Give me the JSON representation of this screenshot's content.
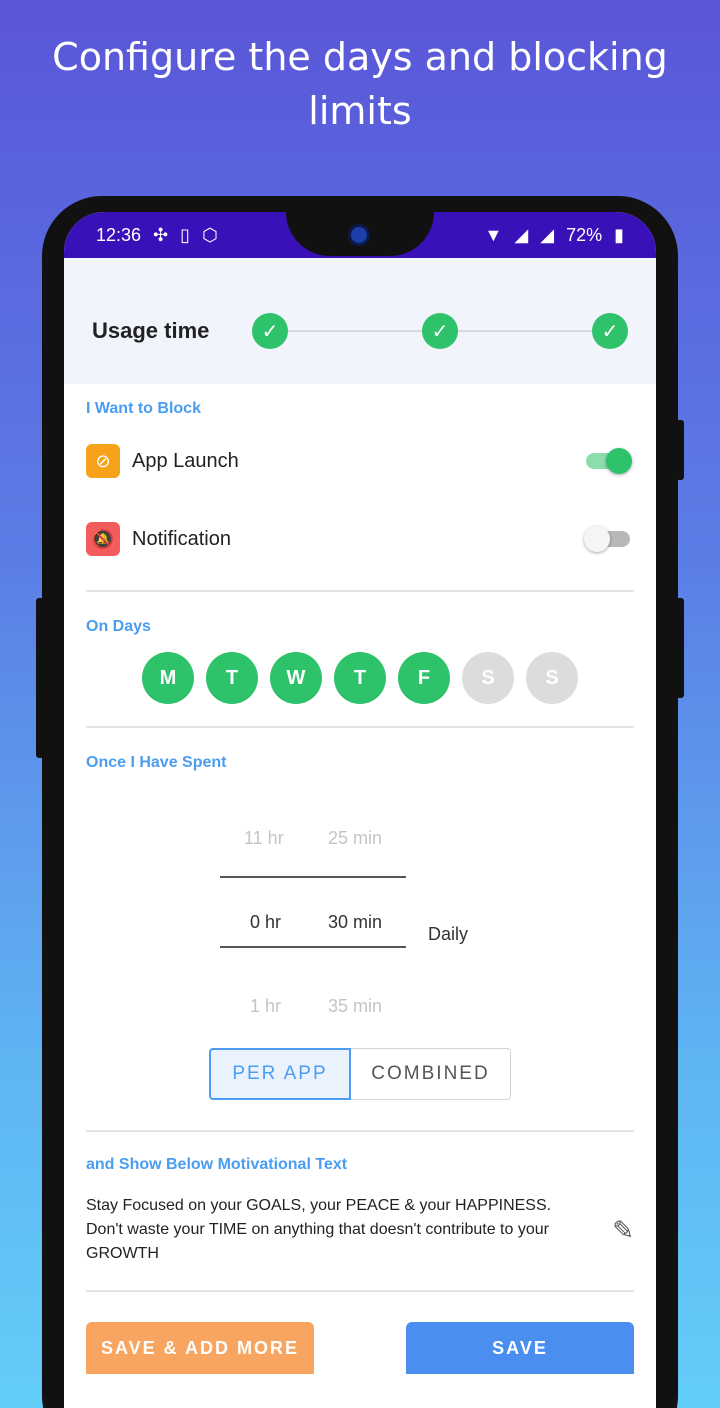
{
  "promo": {
    "title": "Configure the days and blocking limits"
  },
  "status_bar": {
    "time": "12:36",
    "battery": "72%"
  },
  "header": {
    "title": "Usage time"
  },
  "block_section": {
    "label": "I Want to Block",
    "items": [
      {
        "label": "App Launch",
        "enabled": true,
        "icon": "eye-off-icon",
        "icon_color": "#f7a21b"
      },
      {
        "label": "Notification",
        "enabled": false,
        "icon": "bell-off-icon",
        "icon_color": "#f25c5c"
      }
    ]
  },
  "days_section": {
    "label": "On Days",
    "days": [
      {
        "label": "M",
        "active": true
      },
      {
        "label": "T",
        "active": true
      },
      {
        "label": "W",
        "active": true
      },
      {
        "label": "T",
        "active": true
      },
      {
        "label": "F",
        "active": true
      },
      {
        "label": "S",
        "active": false
      },
      {
        "label": "S",
        "active": false
      }
    ]
  },
  "spent_section": {
    "label": "Once I Have Spent",
    "hours_prev": "11 hr",
    "hours_selected": "0 hr",
    "hours_next": "1 hr",
    "minutes_prev": "25 min",
    "minutes_selected": "30 min",
    "minutes_next": "35 min",
    "period": "Daily",
    "mode_per_app": "PER APP",
    "mode_combined": "COMBINED"
  },
  "motivation_section": {
    "label": "and Show Below Motivational Text",
    "text": "Stay Focused on your GOALS, your PEACE & your HAPPINESS. Don't waste your TIME on anything that doesn't contribute to your GROWTH"
  },
  "buttons": {
    "save_add_more": "SAVE & ADD MORE",
    "save": "SAVE"
  },
  "colors": {
    "accent_blue": "#4a9df0",
    "active_green": "#2ec26b",
    "inactive_gray": "#dcdcdc",
    "status_purple": "#3a10b8",
    "save_add_orange": "#f7a560",
    "save_blue": "#4a8ff0"
  }
}
